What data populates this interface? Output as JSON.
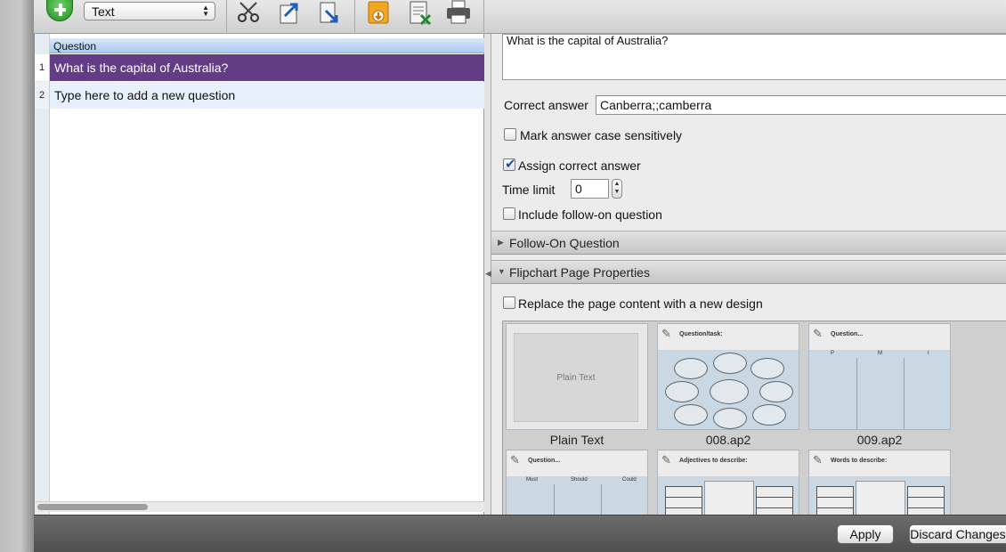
{
  "toolbar": {
    "type_select_value": "Text",
    "icons": [
      "add-question-icon",
      "cut-icon",
      "export-icon",
      "import-icon",
      "flipchart-icon",
      "excel-icon",
      "print-icon"
    ]
  },
  "question_list": {
    "column_header": "Question",
    "rows": [
      {
        "num": "1",
        "text": "What is the capital of Australia?"
      },
      {
        "num": "2",
        "text": "Type here to add a new question"
      }
    ]
  },
  "properties": {
    "question_text": "What is the capital of Australia?",
    "correct_answer_label": "Correct answer",
    "correct_answer_value": "Canberra;;camberra",
    "case_sensitive_label": "Mark answer case sensitively",
    "assign_correct_label": "Assign correct answer",
    "time_limit_label": "Time limit",
    "time_limit_value": "0",
    "follow_on_label": "Include follow-on question",
    "section_follow_on": "Follow-On Question",
    "section_flipchart": "Flipchart Page Properties",
    "replace_page_label": "Replace the page content with a new design"
  },
  "gallery": {
    "cards": [
      {
        "label": "Plain Text",
        "inner": "Plain Text"
      },
      {
        "label": "008.ap2",
        "header": "Question/task:"
      },
      {
        "label": "009.ap2",
        "header": "Question...",
        "cols": [
          "P",
          "M",
          "I"
        ]
      },
      {
        "header": "Question...",
        "cols": [
          "Must",
          "Should",
          "Could"
        ]
      },
      {
        "header": "Adjectives to describe:"
      },
      {
        "header": "Words to describe:"
      }
    ]
  },
  "footer": {
    "apply_label": "Apply",
    "discard_label": "Discard Changes"
  },
  "colors": {
    "selected_row": "#633c86",
    "header_blue": "#aacbf0"
  }
}
